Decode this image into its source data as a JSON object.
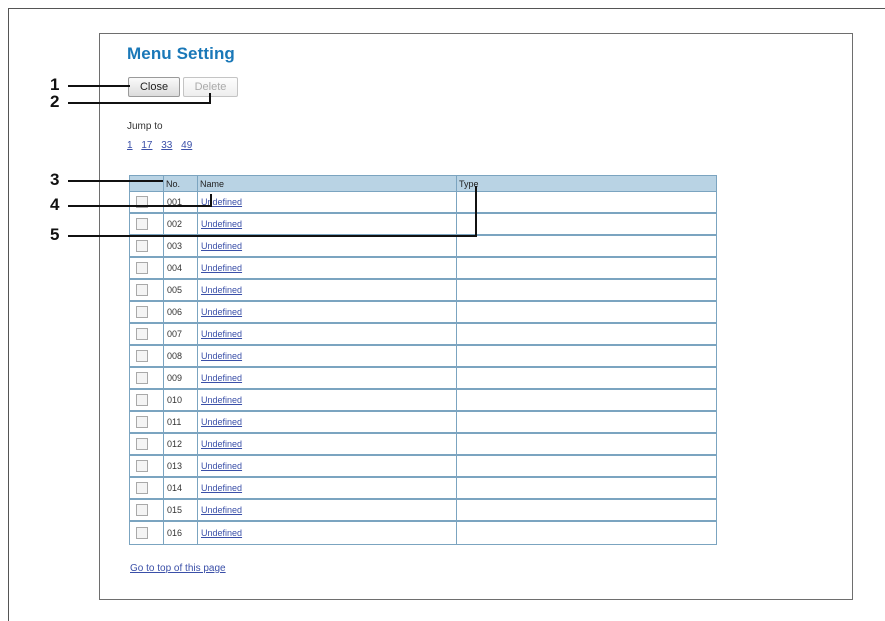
{
  "page": {
    "title": "Menu Setting"
  },
  "toolbar": {
    "close_label": "Close",
    "delete_label": "Delete"
  },
  "jump": {
    "label": "Jump to",
    "links": [
      "1",
      "17",
      "33",
      "49"
    ]
  },
  "table": {
    "headers": [
      "",
      "No.",
      "Name",
      "Type"
    ],
    "rows": [
      {
        "no": "001",
        "name": "Undefined",
        "type": ""
      },
      {
        "no": "002",
        "name": "Undefined",
        "type": ""
      },
      {
        "no": "003",
        "name": "Undefined",
        "type": ""
      },
      {
        "no": "004",
        "name": "Undefined",
        "type": ""
      },
      {
        "no": "005",
        "name": "Undefined",
        "type": ""
      },
      {
        "no": "006",
        "name": "Undefined",
        "type": ""
      },
      {
        "no": "007",
        "name": "Undefined",
        "type": ""
      },
      {
        "no": "008",
        "name": "Undefined",
        "type": ""
      },
      {
        "no": "009",
        "name": "Undefined",
        "type": ""
      },
      {
        "no": "010",
        "name": "Undefined",
        "type": ""
      },
      {
        "no": "011",
        "name": "Undefined",
        "type": ""
      },
      {
        "no": "012",
        "name": "Undefined",
        "type": ""
      },
      {
        "no": "013",
        "name": "Undefined",
        "type": ""
      },
      {
        "no": "014",
        "name": "Undefined",
        "type": ""
      },
      {
        "no": "015",
        "name": "Undefined",
        "type": ""
      },
      {
        "no": "016",
        "name": "Undefined",
        "type": ""
      }
    ]
  },
  "footer": {
    "go_top_label": "Go to top of this page"
  },
  "callouts": [
    "1",
    "2",
    "3",
    "4",
    "5"
  ],
  "colors": {
    "title": "#1a78b8",
    "link": "#3a4fa8",
    "table_header_bg": "#b9d3e4",
    "table_border": "#7ba4c0"
  }
}
